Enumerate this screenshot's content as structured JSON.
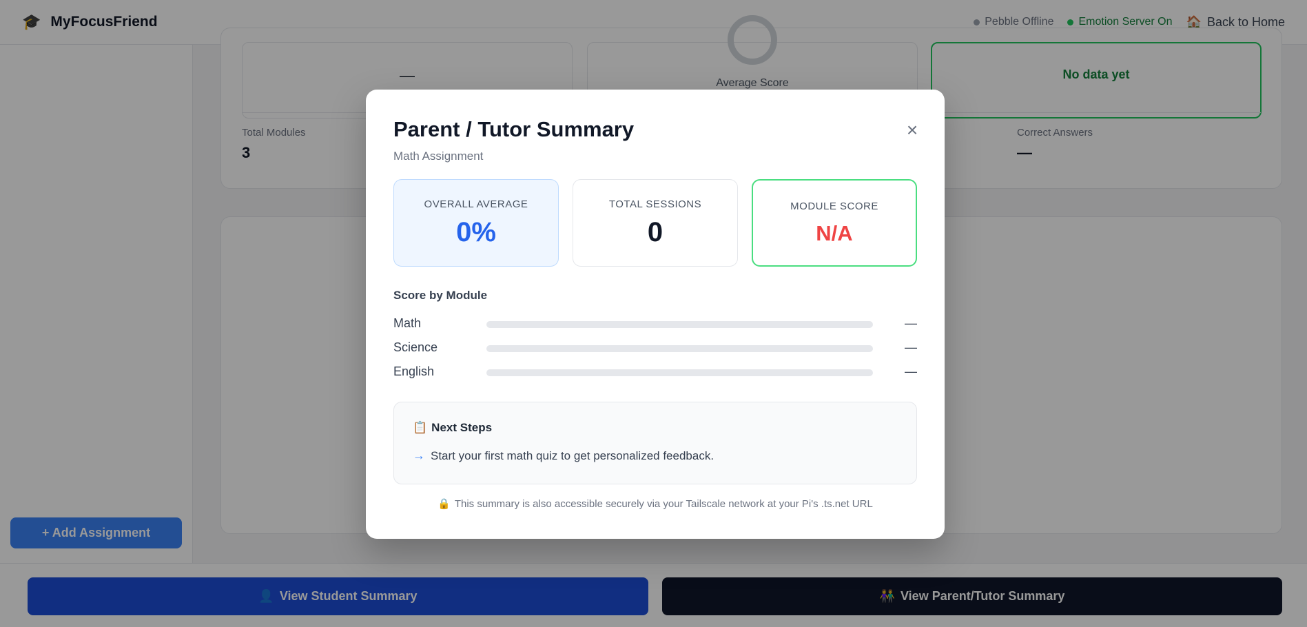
{
  "app": {
    "brand_icon": "🎓",
    "name": "MyFocusFriend",
    "pebble_status": "Pebble Offline",
    "emotion_status": "Emotion Server On",
    "home_icon": "🏠",
    "home_label": "Back to Home"
  },
  "sidebar": {
    "add_label": "+ Add Assignment"
  },
  "dashboard": {
    "card_a_value": "—",
    "card_b_label": "Average Score",
    "card_c_value": "No data yet",
    "stats": [
      {
        "label": "Total Modules",
        "value": "3"
      },
      {
        "label": "Correct Answers",
        "value": "—"
      }
    ]
  },
  "bottom": {
    "student_icon": "👤",
    "student_label": "View Student Summary",
    "parent_icon": "👫",
    "parent_label": "View Parent/Tutor Summary"
  },
  "modal": {
    "title": "Parent / Tutor Summary",
    "subtitle": "Math Assignment",
    "close_icon": "×",
    "cards": [
      {
        "label": "OVERALL AVERAGE",
        "value": "0%"
      },
      {
        "label": "TOTAL SESSIONS",
        "value": "0"
      },
      {
        "label": "MODULE SCORE",
        "value": "N/A"
      }
    ],
    "score_by_module_title": "Score by Module",
    "modules": [
      {
        "name": "Math",
        "value": "—",
        "fill": 0
      },
      {
        "name": "Science",
        "value": "—",
        "fill": 0
      },
      {
        "name": "English",
        "value": "—",
        "fill": 0
      }
    ],
    "next_steps_icon": "📋",
    "next_steps_title": "Next Steps",
    "next_steps_arrow": "→",
    "next_steps": [
      "Start your first math quiz to get personalized feedback."
    ],
    "footer_icon": "🔒",
    "footer": "This summary is also accessible securely via your Tailscale network at your Pi's .ts.net URL"
  },
  "colors": {
    "accent": "#2563eb",
    "success": "#15803d",
    "danger": "#ef4444",
    "offline_dot": "#9ca3af",
    "online_dot": "#22c55e"
  }
}
